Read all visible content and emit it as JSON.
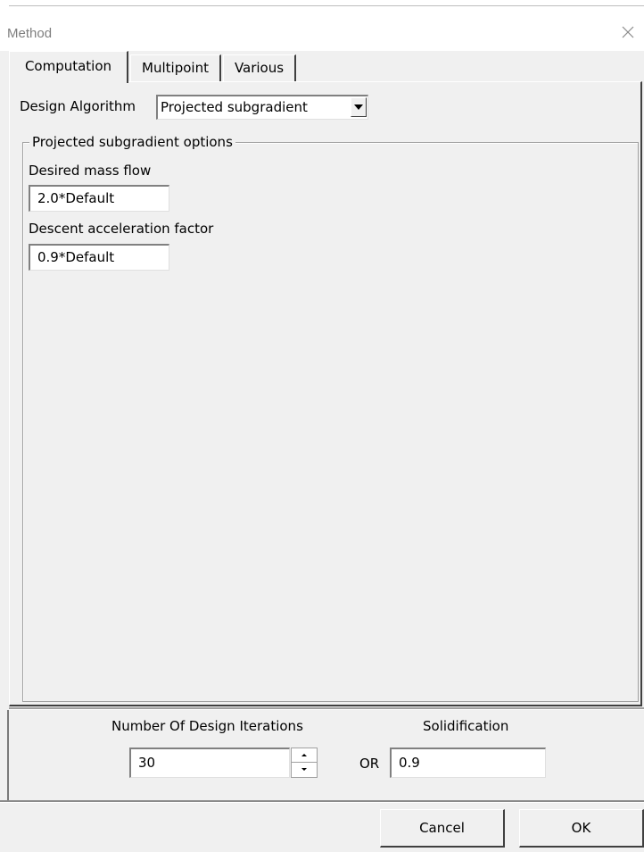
{
  "window": {
    "title": "Method",
    "close_glyph": "×"
  },
  "tabs": [
    {
      "label": "Computation",
      "active": true
    },
    {
      "label": "Multipoint",
      "active": false
    },
    {
      "label": "Various",
      "active": false
    }
  ],
  "design_algorithm": {
    "label": "Design Algorithm",
    "selected": "Projected subgradient"
  },
  "options_group": {
    "title": "Projected subgradient options",
    "desired_mass_flow_label": "Desired mass flow",
    "desired_mass_flow_value": "2.0*Default",
    "descent_acceleration_label": "Descent acceleration factor",
    "descent_acceleration_value": "0.9*Default"
  },
  "footer": {
    "iterations_label": "Number Of Design Iterations",
    "iterations_value": "30",
    "or_label": "OR",
    "solidification_label": "Solidification",
    "solidification_value": "0.9"
  },
  "buttons": {
    "cancel": "Cancel",
    "ok": "OK"
  },
  "colors": {
    "dialog_bg": "#f0f0f0",
    "titlebar_bg": "#ffffff",
    "title_text": "#7f7f7f"
  },
  "icons": {
    "close": "close-icon",
    "dropdown": "chevron-down-icon",
    "spin_up": "arrow-up-icon",
    "spin_down": "arrow-down-icon"
  }
}
